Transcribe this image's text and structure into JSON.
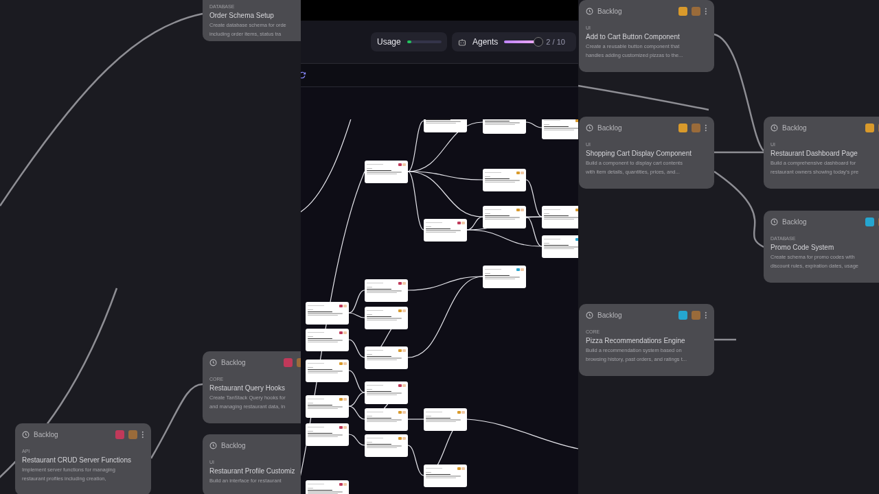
{
  "backdrop_left": [
    {
      "tag": "DATABASE",
      "title": "Order Schema Setup",
      "description": [
        "Create database schema for orde",
        "including order items, status tra"
      ]
    },
    {
      "status": "Backlog",
      "color": "#c0395a",
      "tag": "CORE",
      "title": "Restaurant Query Hooks",
      "description": [
        "Create TanStack Query hooks for",
        "and managing restaurant data, in"
      ]
    },
    {
      "status": "Backlog",
      "color": "#c0395a",
      "tag": "API",
      "title": "Restaurant CRUD Server Functions",
      "description": [
        "Implement server functions for managing",
        "restaurant profiles including creation,"
      ]
    },
    {
      "status": "Backlog",
      "tag": "UI",
      "title": "Restaurant Profile Customiz",
      "description": [
        "Build an interface for restaurant"
      ]
    }
  ],
  "header": {
    "usage": {
      "label": "Usage",
      "level": 0.12
    },
    "agents": {
      "label": "Agents",
      "level": 0.95,
      "reading": "2 / 10"
    }
  },
  "canvas": {
    "nodes": [
      {
        "kind": "task"
      },
      {
        "kind": "task"
      },
      {
        "kind": "task",
        "color": "#d99a2b"
      },
      {
        "kind": "task",
        "color": "#c0395a"
      },
      {
        "kind": "task",
        "color": "#d99a2b"
      },
      {
        "kind": "task",
        "color": "#d99a2b"
      },
      {
        "kind": "task",
        "color": "#d99a2b"
      },
      {
        "kind": "task",
        "color": "#c0395a"
      },
      {
        "kind": "task",
        "color": "#25a6d0"
      },
      {
        "kind": "task",
        "color": "#25a6d0"
      },
      {
        "kind": "task",
        "color": "#c0395a"
      },
      {
        "kind": "task",
        "color": "#c0395a"
      },
      {
        "kind": "task",
        "color": "#d99a2b"
      },
      {
        "kind": "task",
        "color": "#c0395a"
      },
      {
        "kind": "task",
        "color": "#d99a2b"
      },
      {
        "kind": "task",
        "color": "#d99a2b"
      },
      {
        "kind": "task",
        "color": "#c0395a"
      },
      {
        "kind": "task",
        "color": "#d99a2b"
      },
      {
        "kind": "task",
        "color": "#d99a2b"
      },
      {
        "kind": "task",
        "color": "#d99a2b"
      },
      {
        "kind": "task",
        "color": "#c0395a"
      },
      {
        "kind": "task",
        "color": "#d99a2b"
      },
      {
        "kind": "task",
        "color": "#d99a2b"
      },
      {
        "kind": "task",
        "color": "#c0395a"
      }
    ]
  },
  "backdrop_right": [
    {
      "status": "Backlog",
      "color": "#d99a2b",
      "tag": "UI",
      "title": "Add to Cart Button Component",
      "description": [
        "Create a reusable button component that",
        "handles adding customized pizzas to the..."
      ]
    },
    {
      "status": "Backlog",
      "color": "#d99a2b",
      "tag": "UI",
      "title": "Shopping Cart Display Component",
      "description": [
        "Build a component to display cart contents",
        "with item details, quantities, prices, and..."
      ]
    },
    {
      "status": "Backlog",
      "color": "#d99a2b",
      "tag": "UI",
      "title": "Restaurant Dashboard Page",
      "description": [
        "Build a comprehensive dashboard for",
        "restaurant owners showing today's pre"
      ]
    },
    {
      "status": "Backlog",
      "color": "#25a6d0",
      "tag": "DATABASE",
      "title": "Promo Code System",
      "description": [
        "Create schema for promo codes with",
        "discount rules, expiration dates, usage"
      ]
    },
    {
      "status": "Backlog",
      "color": "#25a6d0",
      "tag": "CORE",
      "title": "Pizza Recommendations Engine",
      "description": [
        "Build a recommendation system based on",
        "browsing history, past orders, and ratings t..."
      ]
    }
  ]
}
